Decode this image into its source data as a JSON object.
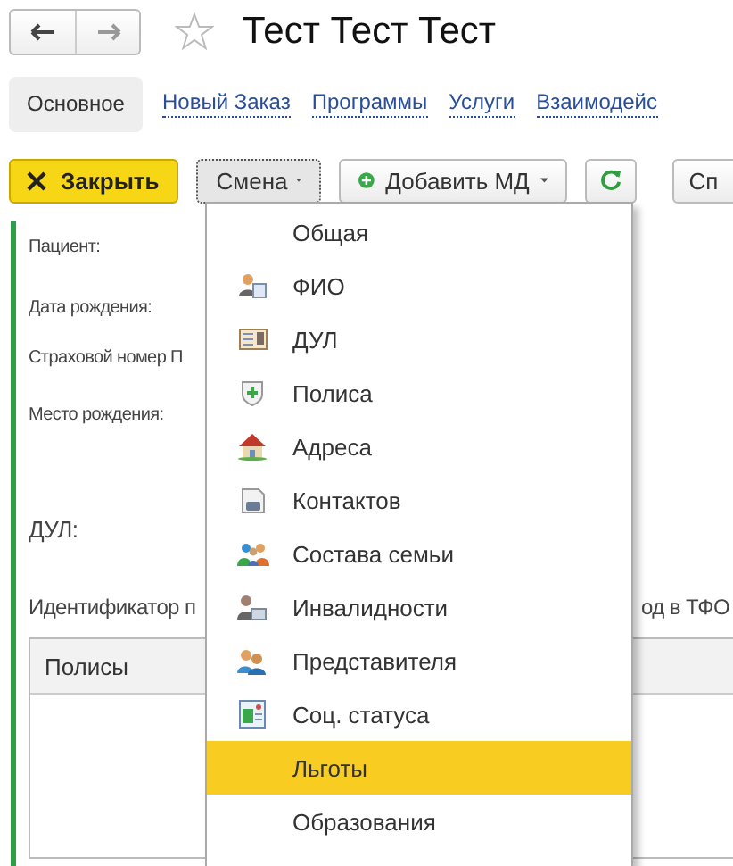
{
  "window": {
    "title": "Тест Тест Тест",
    "favorite": false
  },
  "tabs": [
    {
      "label": "Основное",
      "selected": true
    },
    {
      "label": "Новый Заказ",
      "selected": false
    },
    {
      "label": "Программы",
      "selected": false
    },
    {
      "label": "Услуги",
      "selected": false
    },
    {
      "label": "Взаимодейс",
      "selected": false
    }
  ],
  "toolbar": {
    "close": "Закрыть",
    "change": "Смена",
    "add": "Добавить МД",
    "cut_button": "Сп"
  },
  "fields": [
    {
      "label": "Пациент:"
    },
    {
      "label": "Дата рождения:"
    },
    {
      "label": "Страховой номер П"
    },
    {
      "label": "Место рождения:"
    },
    {
      "label": "ДУЛ:"
    }
  ],
  "identifier": {
    "left": "Идентификатор п",
    "right": "од в ТФО"
  },
  "table": {
    "columns": [
      "Полисы"
    ]
  },
  "menu": [
    {
      "label": "Общая",
      "selected": false
    },
    {
      "label": "ФИО",
      "selected": false
    },
    {
      "label": "ДУЛ",
      "selected": false
    },
    {
      "label": "Полиса",
      "selected": false
    },
    {
      "label": "Адреса",
      "selected": false
    },
    {
      "label": "Контактов",
      "selected": false
    },
    {
      "label": "Состава семьи",
      "selected": false
    },
    {
      "label": "Инвалидности",
      "selected": false
    },
    {
      "label": "Представителя",
      "selected": false
    },
    {
      "label": "Соц. статуса",
      "selected": false
    },
    {
      "label": "Льготы",
      "selected": true
    },
    {
      "label": "Образования",
      "selected": false
    }
  ]
}
